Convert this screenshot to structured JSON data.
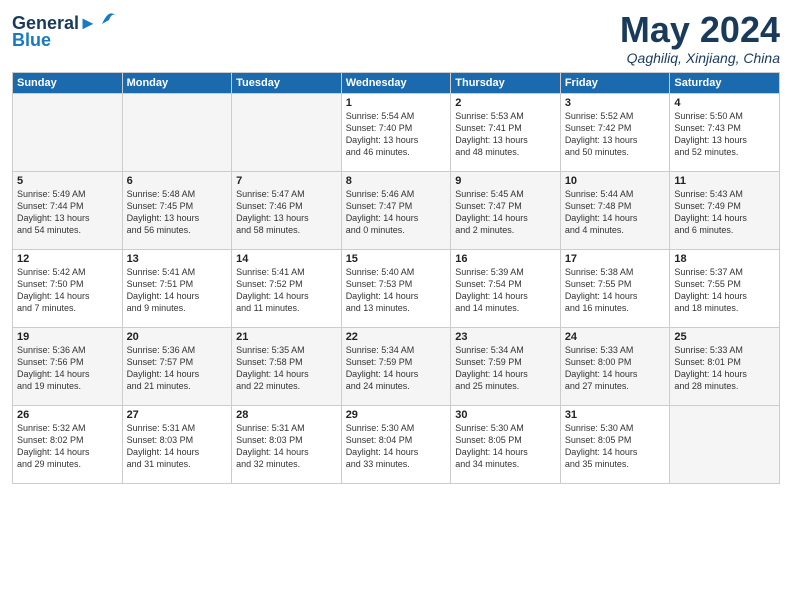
{
  "header": {
    "logo_line1": "General",
    "logo_line2": "Blue",
    "month": "May 2024",
    "location": "Qaghiliq, Xinjiang, China"
  },
  "weekdays": [
    "Sunday",
    "Monday",
    "Tuesday",
    "Wednesday",
    "Thursday",
    "Friday",
    "Saturday"
  ],
  "weeks": [
    [
      {
        "day": "",
        "info": ""
      },
      {
        "day": "",
        "info": ""
      },
      {
        "day": "",
        "info": ""
      },
      {
        "day": "1",
        "info": "Sunrise: 5:54 AM\nSunset: 7:40 PM\nDaylight: 13 hours\nand 46 minutes."
      },
      {
        "day": "2",
        "info": "Sunrise: 5:53 AM\nSunset: 7:41 PM\nDaylight: 13 hours\nand 48 minutes."
      },
      {
        "day": "3",
        "info": "Sunrise: 5:52 AM\nSunset: 7:42 PM\nDaylight: 13 hours\nand 50 minutes."
      },
      {
        "day": "4",
        "info": "Sunrise: 5:50 AM\nSunset: 7:43 PM\nDaylight: 13 hours\nand 52 minutes."
      }
    ],
    [
      {
        "day": "5",
        "info": "Sunrise: 5:49 AM\nSunset: 7:44 PM\nDaylight: 13 hours\nand 54 minutes."
      },
      {
        "day": "6",
        "info": "Sunrise: 5:48 AM\nSunset: 7:45 PM\nDaylight: 13 hours\nand 56 minutes."
      },
      {
        "day": "7",
        "info": "Sunrise: 5:47 AM\nSunset: 7:46 PM\nDaylight: 13 hours\nand 58 minutes."
      },
      {
        "day": "8",
        "info": "Sunrise: 5:46 AM\nSunset: 7:47 PM\nDaylight: 14 hours\nand 0 minutes."
      },
      {
        "day": "9",
        "info": "Sunrise: 5:45 AM\nSunset: 7:47 PM\nDaylight: 14 hours\nand 2 minutes."
      },
      {
        "day": "10",
        "info": "Sunrise: 5:44 AM\nSunset: 7:48 PM\nDaylight: 14 hours\nand 4 minutes."
      },
      {
        "day": "11",
        "info": "Sunrise: 5:43 AM\nSunset: 7:49 PM\nDaylight: 14 hours\nand 6 minutes."
      }
    ],
    [
      {
        "day": "12",
        "info": "Sunrise: 5:42 AM\nSunset: 7:50 PM\nDaylight: 14 hours\nand 7 minutes."
      },
      {
        "day": "13",
        "info": "Sunrise: 5:41 AM\nSunset: 7:51 PM\nDaylight: 14 hours\nand 9 minutes."
      },
      {
        "day": "14",
        "info": "Sunrise: 5:41 AM\nSunset: 7:52 PM\nDaylight: 14 hours\nand 11 minutes."
      },
      {
        "day": "15",
        "info": "Sunrise: 5:40 AM\nSunset: 7:53 PM\nDaylight: 14 hours\nand 13 minutes."
      },
      {
        "day": "16",
        "info": "Sunrise: 5:39 AM\nSunset: 7:54 PM\nDaylight: 14 hours\nand 14 minutes."
      },
      {
        "day": "17",
        "info": "Sunrise: 5:38 AM\nSunset: 7:55 PM\nDaylight: 14 hours\nand 16 minutes."
      },
      {
        "day": "18",
        "info": "Sunrise: 5:37 AM\nSunset: 7:55 PM\nDaylight: 14 hours\nand 18 minutes."
      }
    ],
    [
      {
        "day": "19",
        "info": "Sunrise: 5:36 AM\nSunset: 7:56 PM\nDaylight: 14 hours\nand 19 minutes."
      },
      {
        "day": "20",
        "info": "Sunrise: 5:36 AM\nSunset: 7:57 PM\nDaylight: 14 hours\nand 21 minutes."
      },
      {
        "day": "21",
        "info": "Sunrise: 5:35 AM\nSunset: 7:58 PM\nDaylight: 14 hours\nand 22 minutes."
      },
      {
        "day": "22",
        "info": "Sunrise: 5:34 AM\nSunset: 7:59 PM\nDaylight: 14 hours\nand 24 minutes."
      },
      {
        "day": "23",
        "info": "Sunrise: 5:34 AM\nSunset: 7:59 PM\nDaylight: 14 hours\nand 25 minutes."
      },
      {
        "day": "24",
        "info": "Sunrise: 5:33 AM\nSunset: 8:00 PM\nDaylight: 14 hours\nand 27 minutes."
      },
      {
        "day": "25",
        "info": "Sunrise: 5:33 AM\nSunset: 8:01 PM\nDaylight: 14 hours\nand 28 minutes."
      }
    ],
    [
      {
        "day": "26",
        "info": "Sunrise: 5:32 AM\nSunset: 8:02 PM\nDaylight: 14 hours\nand 29 minutes."
      },
      {
        "day": "27",
        "info": "Sunrise: 5:31 AM\nSunset: 8:03 PM\nDaylight: 14 hours\nand 31 minutes."
      },
      {
        "day": "28",
        "info": "Sunrise: 5:31 AM\nSunset: 8:03 PM\nDaylight: 14 hours\nand 32 minutes."
      },
      {
        "day": "29",
        "info": "Sunrise: 5:30 AM\nSunset: 8:04 PM\nDaylight: 14 hours\nand 33 minutes."
      },
      {
        "day": "30",
        "info": "Sunrise: 5:30 AM\nSunset: 8:05 PM\nDaylight: 14 hours\nand 34 minutes."
      },
      {
        "day": "31",
        "info": "Sunrise: 5:30 AM\nSunset: 8:05 PM\nDaylight: 14 hours\nand 35 minutes."
      },
      {
        "day": "",
        "info": ""
      }
    ]
  ]
}
